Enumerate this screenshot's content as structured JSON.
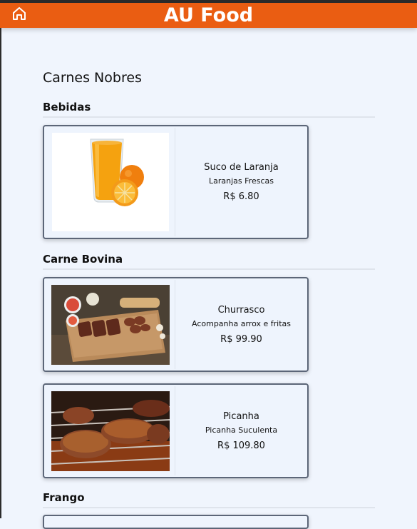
{
  "app": {
    "title": "AU Food"
  },
  "restaurant": {
    "name": "Carnes Nobres"
  },
  "sections": [
    {
      "title": "Bebidas",
      "items": [
        {
          "name": "Suco de Laranja",
          "description": "Laranjas Frescas",
          "price": "R$ 6.80",
          "image": "orange-juice-photo"
        }
      ]
    },
    {
      "title": "Carne Bovina",
      "items": [
        {
          "name": "Churrasco",
          "description": "Acompanha arrox e fritas",
          "price": "R$ 99.90",
          "image": "barbecue-board-photo"
        },
        {
          "name": "Picanha",
          "description": "Picanha Suculenta",
          "price": "R$ 109.80",
          "image": "grilled-picanha-photo"
        }
      ]
    },
    {
      "title": "Frango",
      "items": []
    }
  ],
  "colors": {
    "header": "#ea5d12",
    "background": "#f0f5fd",
    "card_border": "#5c6678"
  }
}
